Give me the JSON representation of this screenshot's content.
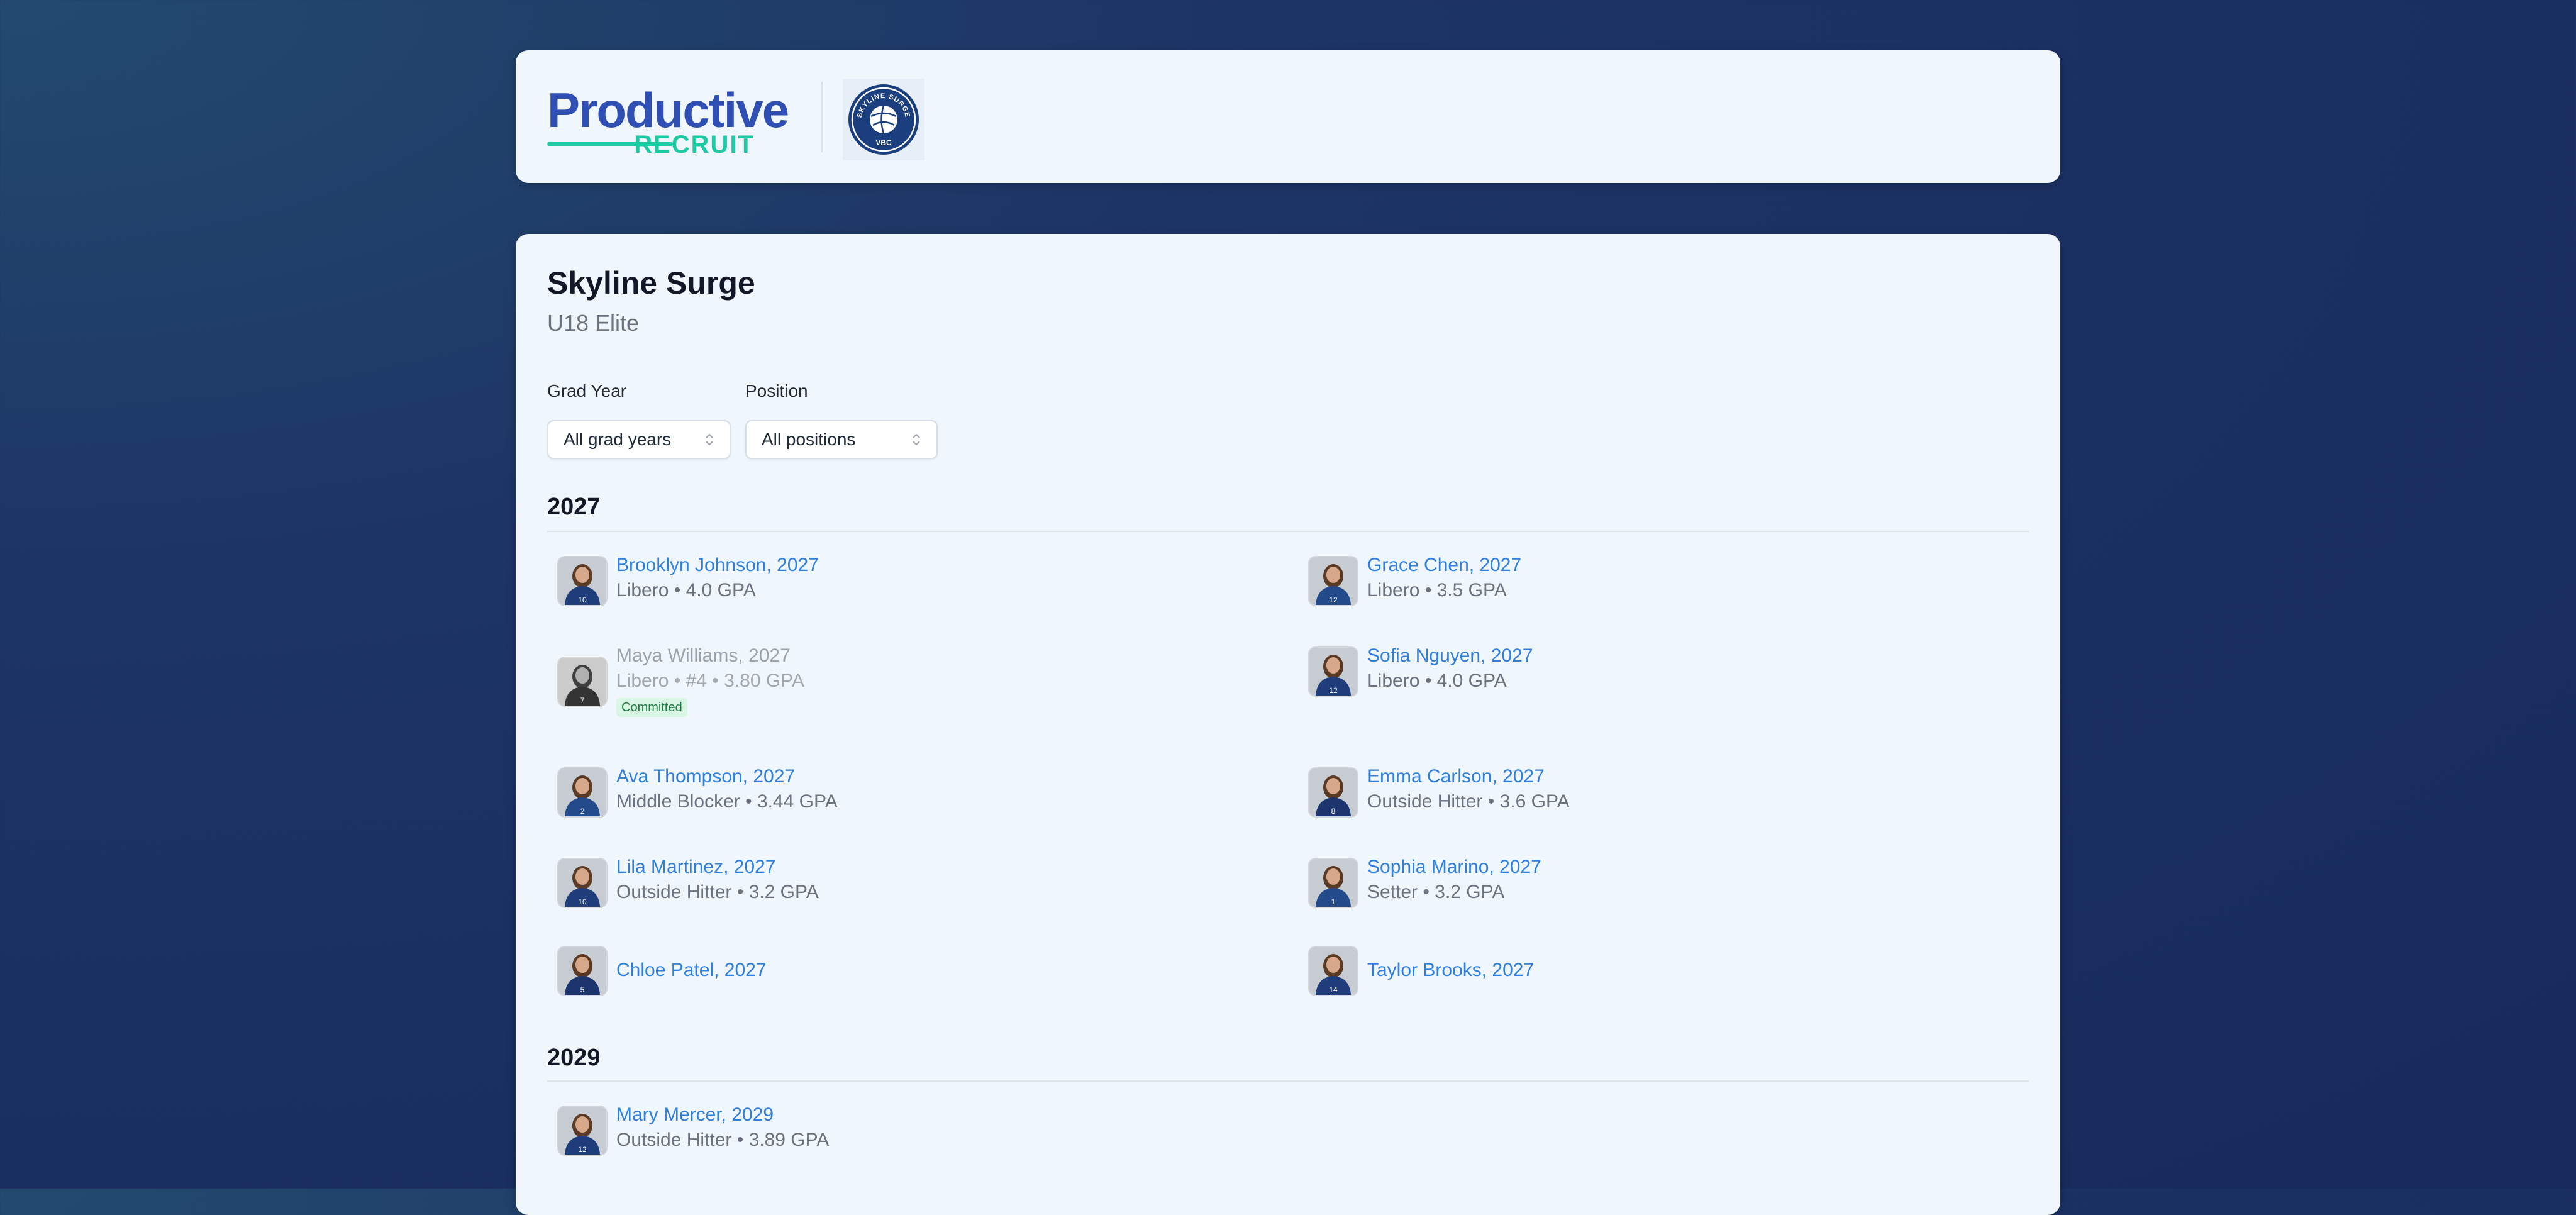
{
  "brand": {
    "word": "Productive",
    "sub": "RECRUIT"
  },
  "club_logo": {
    "arc_text": "SKYLINE SURGE",
    "initials": "VBC"
  },
  "team": {
    "name": "Skyline Surge",
    "division": "U18 Elite"
  },
  "filters": {
    "grad_year": {
      "label": "Grad Year",
      "value": "All grad years"
    },
    "position": {
      "label": "Position",
      "value": "All positions"
    }
  },
  "groups": [
    {
      "year": "2027",
      "players": [
        {
          "name": "Brooklyn Johnson, 2027",
          "meta": "Libero • 4.0 GPA",
          "jersey": "10"
        },
        {
          "name": "Grace Chen, 2027",
          "meta": "Libero • 3.5 GPA",
          "jersey": "12"
        },
        {
          "name": "Maya Williams, 2027",
          "meta": "Libero • #4 • 3.80 GPA",
          "badge": "Committed",
          "jersey": "7"
        },
        {
          "name": "Sofia Nguyen, 2027",
          "meta": "Libero • 4.0 GPA",
          "jersey": "12"
        },
        {
          "name": "Ava Thompson, 2027",
          "meta": "Middle Blocker • 3.44 GPA",
          "jersey": "2"
        },
        {
          "name": "Emma Carlson, 2027",
          "meta": "Outside Hitter • 3.6 GPA",
          "jersey": "8"
        },
        {
          "name": "Lila Martinez, 2027",
          "meta": "Outside Hitter • 3.2 GPA",
          "jersey": "10"
        },
        {
          "name": "Sophia Marino, 2027",
          "meta": "Setter • 3.2 GPA",
          "jersey": "1"
        },
        {
          "name": "Chloe Patel, 2027",
          "meta": "",
          "jersey": "5"
        },
        {
          "name": "Taylor Brooks, 2027",
          "meta": "",
          "jersey": "14"
        }
      ]
    },
    {
      "year": "2029",
      "players": [
        {
          "name": "Mary Mercer, 2029",
          "meta": "Outside Hitter • 3.89 GPA",
          "jersey": "12"
        }
      ]
    }
  ],
  "colors": {
    "link": "#2f7ee0",
    "brand_blue": "#2f4fb5",
    "brand_teal": "#1ec9a4",
    "badge_bg": "#d9f5e3",
    "badge_text": "#1e7c43"
  }
}
